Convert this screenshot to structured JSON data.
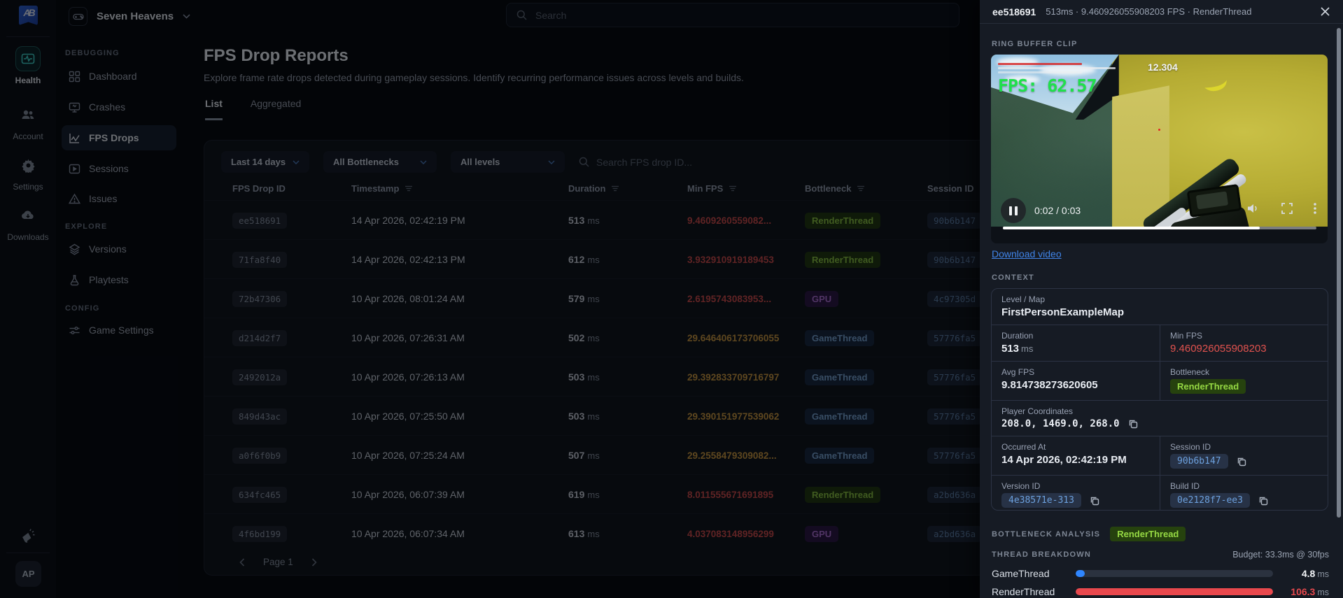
{
  "topbar": {
    "game_name": "Seven Heavens",
    "search_placeholder": "Search"
  },
  "rail": {
    "items": [
      "Health",
      "Account",
      "Settings",
      "Downloads"
    ],
    "avatar_initials": "AP"
  },
  "sidenav": {
    "sections": [
      {
        "title": "DEBUGGING",
        "items": [
          "Dashboard",
          "Crashes",
          "FPS Drops",
          "Sessions",
          "Issues"
        ]
      },
      {
        "title": "EXPLORE",
        "items": [
          "Versions",
          "Playtests"
        ]
      },
      {
        "title": "CONFIG",
        "items": [
          "Game Settings"
        ]
      }
    ]
  },
  "page": {
    "title": "FPS Drop Reports",
    "description": "Explore frame rate drops detected during gameplay sessions. Identify recurring performance issues across levels and builds.",
    "tabs": [
      "List",
      "Aggregated"
    ]
  },
  "filters": {
    "date_range": "Last 14 days",
    "bottleneck": "All Bottlenecks",
    "level": "All levels",
    "search_placeholder": "Search FPS drop ID..."
  },
  "table": {
    "columns": [
      "FPS Drop ID",
      "Timestamp",
      "Duration",
      "Min FPS",
      "Bottleneck",
      "Session ID"
    ],
    "unit": "ms",
    "rows": [
      {
        "id": "ee518691",
        "timestamp": "14 Apr 2026, 02:42:19 PM",
        "duration": "513",
        "min_fps": "9.4609260559082...",
        "fps_class": "fps-red",
        "bottleneck": "RenderThread",
        "bn_class": "bn-green",
        "session": "90b6b147"
      },
      {
        "id": "71fa8f40",
        "timestamp": "14 Apr 2026, 02:42:13 PM",
        "duration": "612",
        "min_fps": "3.932910919189453",
        "fps_class": "fps-red",
        "bottleneck": "RenderThread",
        "bn_class": "bn-green",
        "session": "90b6b147"
      },
      {
        "id": "72b47306",
        "timestamp": "10 Apr 2026, 08:01:24 AM",
        "duration": "579",
        "min_fps": "2.6195743083953...",
        "fps_class": "fps-red",
        "bottleneck": "GPU",
        "bn_class": "bn-purple",
        "session": "4c97305d"
      },
      {
        "id": "d214d2f7",
        "timestamp": "10 Apr 2026, 07:26:31 AM",
        "duration": "502",
        "min_fps": "29.646406173706055",
        "fps_class": "fps-amber",
        "bottleneck": "GameThread",
        "bn_class": "bn-blue",
        "session": "57776fa5"
      },
      {
        "id": "2492012a",
        "timestamp": "10 Apr 2026, 07:26:13 AM",
        "duration": "503",
        "min_fps": "29.392833709716797",
        "fps_class": "fps-amber",
        "bottleneck": "GameThread",
        "bn_class": "bn-blue",
        "session": "57776fa5"
      },
      {
        "id": "849d43ac",
        "timestamp": "10 Apr 2026, 07:25:50 AM",
        "duration": "503",
        "min_fps": "29.390151977539062",
        "fps_class": "fps-amber",
        "bottleneck": "GameThread",
        "bn_class": "bn-blue",
        "session": "57776fa5"
      },
      {
        "id": "a0f6f0b9",
        "timestamp": "10 Apr 2026, 07:25:24 AM",
        "duration": "507",
        "min_fps": "29.2558479309082...",
        "fps_class": "fps-amber",
        "bottleneck": "GameThread",
        "bn_class": "bn-blue",
        "session": "57776fa5"
      },
      {
        "id": "634fc465",
        "timestamp": "10 Apr 2026, 06:07:39 AM",
        "duration": "619",
        "min_fps": "8.011555671691895",
        "fps_class": "fps-red",
        "bottleneck": "RenderThread",
        "bn_class": "bn-green",
        "session": "a2bd636a"
      },
      {
        "id": "4f6bd199",
        "timestamp": "10 Apr 2026, 06:07:34 AM",
        "duration": "613",
        "min_fps": "4.037083148956299",
        "fps_class": "fps-red",
        "bottleneck": "GPU",
        "bn_class": "bn-purple",
        "session": "a2bd636a"
      }
    ],
    "pagination_label": "Page 1"
  },
  "panel": {
    "drop_id": "ee518691",
    "subtitle": "513ms · 9.460926055908203 FPS · RenderThread",
    "section_clip": "RING BUFFER CLIP",
    "video": {
      "debug_time": "12.304",
      "fps_overlay": "FPS: 62.57",
      "time": "0:02 / 0:03",
      "progress_pct": 82
    },
    "download_label": "Download video",
    "section_context": "CONTEXT",
    "context": {
      "level_label": "Level / Map",
      "level_value": "FirstPersonExampleMap",
      "duration_label": "Duration",
      "duration_value": "513",
      "duration_unit": "ms",
      "min_fps_label": "Min FPS",
      "min_fps_value": "9.460926055908203",
      "avg_fps_label": "Avg FPS",
      "avg_fps_value": "9.814738273620605",
      "bottleneck_label": "Bottleneck",
      "bottleneck_value": "RenderThread",
      "coords_label": "Player Coordinates",
      "coords_value": "208.0, 1469.0, 268.0",
      "occurred_label": "Occurred At",
      "occurred_value": "14 Apr 2026, 02:42:19 PM",
      "session_label": "Session ID",
      "session_value": "90b6b147",
      "version_label": "Version ID",
      "version_value": "4e38571e-313",
      "build_label": "Build ID",
      "build_value": "0e2128f7-ee3"
    },
    "section_bottleneck": "BOTTLENECK ANALYSIS",
    "bottleneck_badge": "RenderThread",
    "section_threads": "THREAD BREAKDOWN",
    "budget_label": "Budget: 33.3ms @ 30fps",
    "threads": [
      {
        "name": "GameThread",
        "value": "4.8",
        "unit": "ms",
        "pct": 4.5,
        "bar_class": "bar-blue",
        "value_class": "val-white"
      },
      {
        "name": "RenderThread",
        "value": "106.3",
        "unit": "ms",
        "pct": 100,
        "bar_class": "bar-red",
        "value_class": "val-red"
      }
    ]
  },
  "colors": {
    "accent_blue": "#2f86ff",
    "critical_red": "#e5484d",
    "warn_amber": "#cf9a3d",
    "ok_green": "#95d843",
    "link_blue": "#4084e8"
  }
}
